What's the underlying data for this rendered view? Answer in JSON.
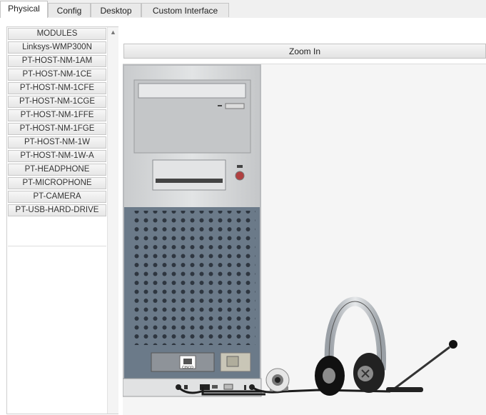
{
  "tabs": [
    {
      "label": "Physical"
    },
    {
      "label": "Config"
    },
    {
      "label": "Desktop"
    },
    {
      "label": "Custom Interface"
    }
  ],
  "modules": {
    "header": "MODULES",
    "items": [
      "Linksys-WMP300N",
      "PT-HOST-NM-1AM",
      "PT-HOST-NM-1CE",
      "PT-HOST-NM-1CFE",
      "PT-HOST-NM-1CGE",
      "PT-HOST-NM-1FFE",
      "PT-HOST-NM-1FGE",
      "PT-HOST-NM-1W",
      "PT-HOST-NM-1W-A",
      "PT-HEADPHONE",
      "PT-MICROPHONE",
      "PT-CAMERA",
      "PT-USB-HARD-DRIVE"
    ]
  },
  "zoom": {
    "label": "Zoom In"
  },
  "device": {
    "nic_label": "CISCO"
  },
  "colors": {
    "tower_silver": "#d9dbdc",
    "tower_grille": "#6b7a89",
    "canvas_bg": "#f5f5f5"
  }
}
